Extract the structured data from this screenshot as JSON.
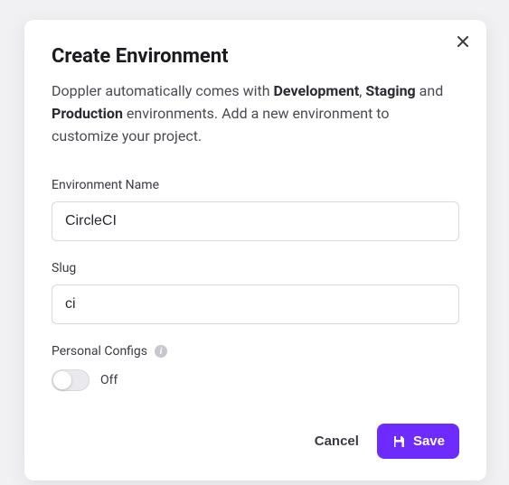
{
  "modal": {
    "title": "Create Environment",
    "description": {
      "pre": "Doppler automatically comes with ",
      "b1": "Development",
      "sep1": ", ",
      "b2": "Staging",
      "mid": " and ",
      "b3": "Production",
      "post": " environments. Add a new environment to customize your project."
    },
    "fields": {
      "envName": {
        "label": "Environment Name",
        "value": "CircleCI",
        "placeholder": ""
      },
      "slug": {
        "label": "Slug",
        "value": "ci",
        "placeholder": ""
      },
      "personalConfigs": {
        "label": "Personal Configs",
        "state": "Off"
      }
    },
    "actions": {
      "cancel": "Cancel",
      "save": "Save"
    }
  }
}
